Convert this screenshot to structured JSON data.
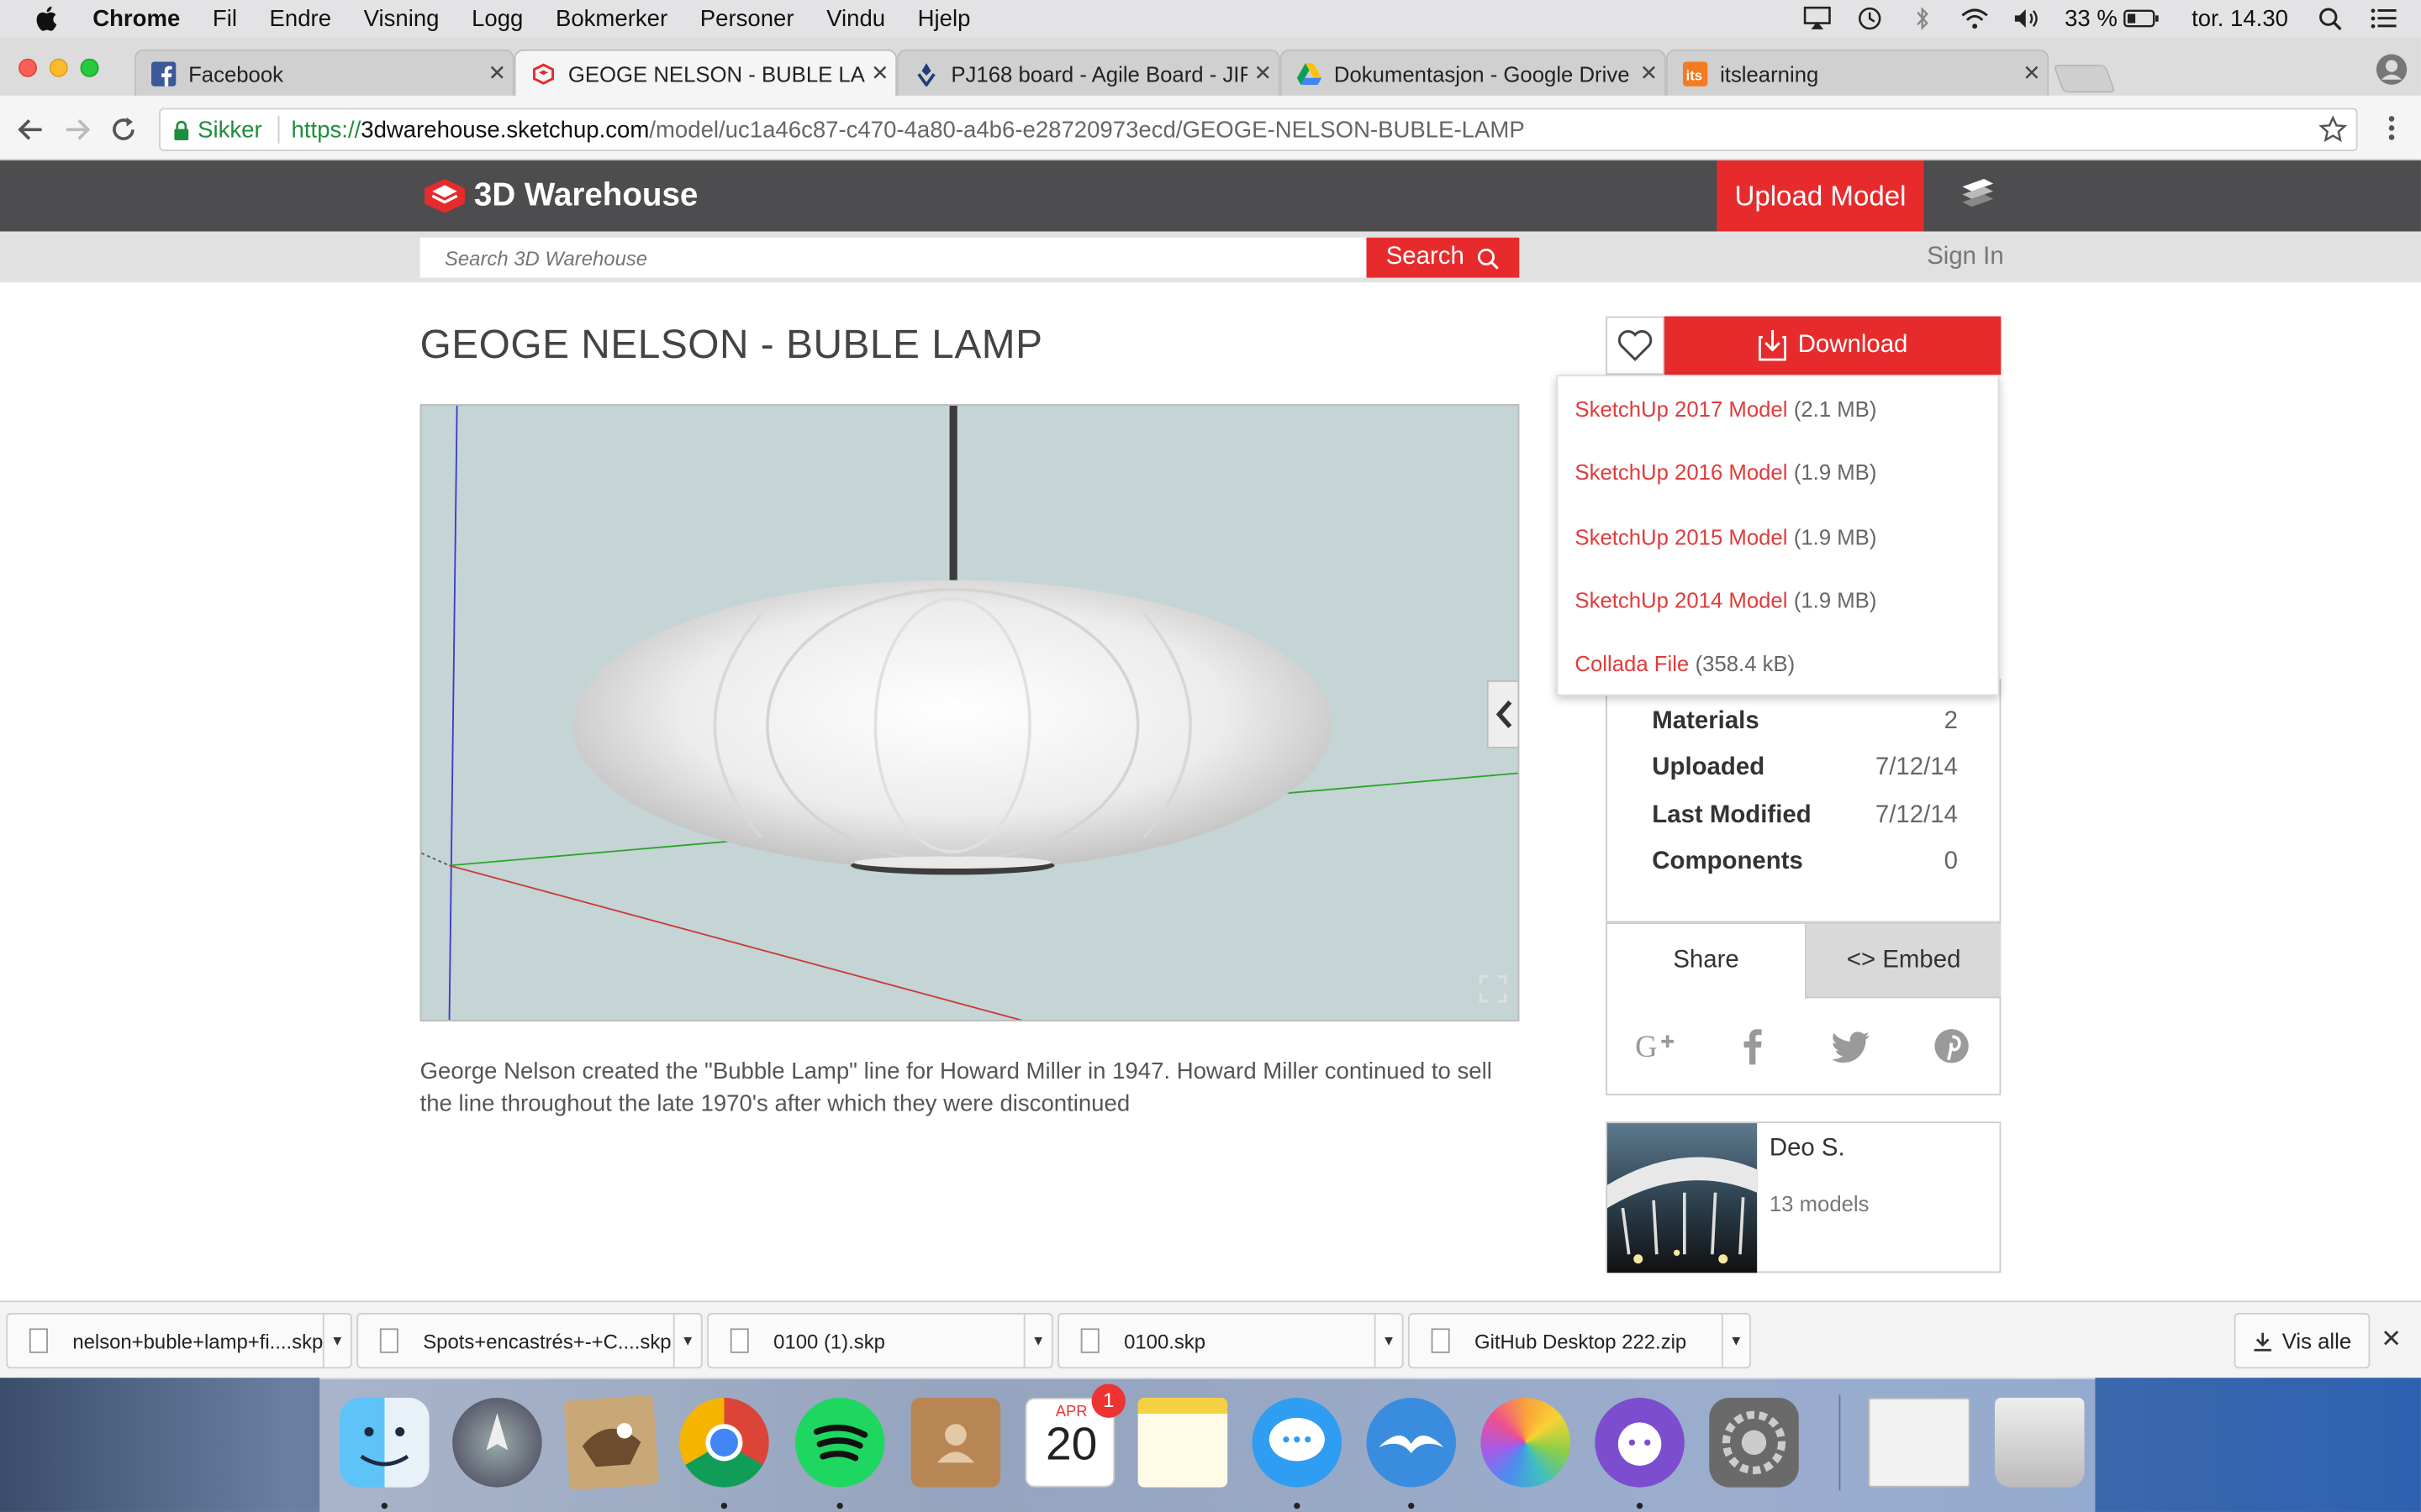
{
  "menubar": {
    "app_name": "Chrome",
    "items": [
      "Fil",
      "Endre",
      "Visning",
      "Logg",
      "Bokmerker",
      "Personer",
      "Vindu",
      "Hjelp"
    ],
    "battery": "33 %",
    "clock": "tor. 14.30"
  },
  "tabs": [
    {
      "title": "Facebook",
      "icon": "facebook-icon"
    },
    {
      "title": "GEOGE NELSON - BUBLE LAMP",
      "icon": "sketchup-icon"
    },
    {
      "title": "PJ168 board - Agile Board - JIRA",
      "icon": "jira-icon"
    },
    {
      "title": "Dokumentasjon - Google Drive",
      "icon": "google-drive-icon"
    },
    {
      "title": "itslearning",
      "icon": "itslearning-icon"
    }
  ],
  "address": {
    "secure_label": "Sikker",
    "scheme": "https://",
    "host": "3dwarehouse.sketchup.com",
    "path": "/model/uc1a46c87-c470-4a80-a4b6-e28720973ecd/GEOGE-NELSON-BUBLE-LAMP"
  },
  "site": {
    "logo_text": "3D Warehouse",
    "upload_label": "Upload Model",
    "search_placeholder": "Search 3D Warehouse",
    "search_label": "Search",
    "signin_label": "Sign In",
    "brand_color": "#e72b2d"
  },
  "model": {
    "title": "GEOGE NELSON - BUBLE LAMP",
    "description": "George Nelson created the \"Bubble Lamp\" line for Howard Miller in 1947. Howard Miller continued to sell the line throughout the late 1970's after which they were discontinued"
  },
  "download": {
    "label": "Download",
    "options": [
      {
        "name": "SketchUp 2017 Model",
        "size": "(2.1 MB)"
      },
      {
        "name": "SketchUp 2016 Model",
        "size": "(1.9 MB)"
      },
      {
        "name": "SketchUp 2015 Model",
        "size": "(1.9 MB)"
      },
      {
        "name": "SketchUp 2014 Model",
        "size": "(1.9 MB)"
      },
      {
        "name": "Collada File",
        "size": "(358.4 kB)"
      }
    ]
  },
  "stats": [
    {
      "label": "Materials",
      "value": "2"
    },
    {
      "label": "Uploaded",
      "value": "7/12/14"
    },
    {
      "label": "Last Modified",
      "value": "7/12/14"
    },
    {
      "label": "Components",
      "value": "0"
    }
  ],
  "share": {
    "share_label": "Share",
    "embed_label": "<> Embed"
  },
  "author": {
    "name": "Deo S.",
    "models": "13 models"
  },
  "downloads_shelf": {
    "files": [
      "nelson+buble+lamp+fi....skp",
      "Spots+encastrés+-+C....skp",
      "0100 (1).skp",
      "0100.skp",
      "GitHub Desktop 222.zip"
    ],
    "show_all": "Vis alle"
  },
  "dock": {
    "calendar_month": "APR",
    "calendar_day": "20",
    "badge": "1"
  }
}
